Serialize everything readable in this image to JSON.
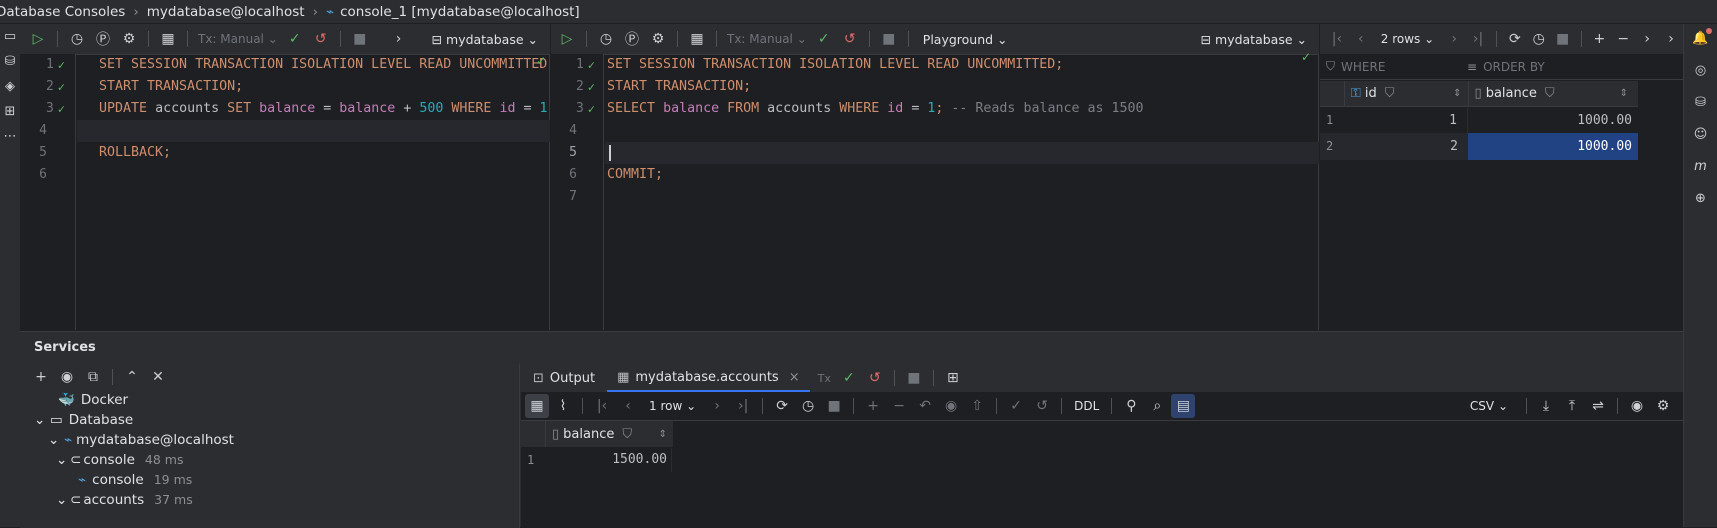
{
  "breadcrumb": {
    "items": [
      "Database Consoles",
      "mydatabase@localhost",
      "console_1 [mydatabase@localhost]"
    ]
  },
  "left_toolbar": {
    "tx_mode": "Tx: Manual",
    "datasource": "mydatabase"
  },
  "right_toolbar": {
    "tx_mode": "Tx: Manual",
    "mode": "Playground",
    "datasource": "mydatabase"
  },
  "result_toolbar": {
    "rows_label": "2 rows"
  },
  "left_editor": {
    "line_numbers": [
      "1",
      "2",
      "3",
      "4",
      "5",
      "6"
    ],
    "lines": {
      "l1": "SET SESSION TRANSACTION ISOLATION LEVEL READ UNCOMMITTED;",
      "l2": "START TRANSACTION;",
      "l3": {
        "k1": "UPDATE",
        "t1": "accounts",
        "k2": "SET",
        "c1": "balance",
        "eq": "=",
        "c2": "balance",
        "plus": "+",
        "n1": "500",
        "k3": "WHERE",
        "c3": "id",
        "eq2": "=",
        "n2": "1",
        "semi": ";",
        "cm": "--"
      },
      "l5": "ROLLBACK;"
    }
  },
  "right_editor": {
    "line_numbers": [
      "1",
      "2",
      "3",
      "4",
      "5",
      "6",
      "7"
    ],
    "lines": {
      "l1": "SET SESSION TRANSACTION ISOLATION LEVEL READ UNCOMMITTED;",
      "l2": "START TRANSACTION;",
      "l3": {
        "k1": "SELECT",
        "c1": "balance",
        "k2": "FROM",
        "t1": "accounts",
        "k3": "WHERE",
        "c2": "id",
        "eq": "=",
        "n1": "1",
        "semi": ";",
        "cm": "-- Reads balance as 1500"
      },
      "l6": "COMMIT;"
    }
  },
  "result_grid": {
    "filter_where": "WHERE",
    "filter_order": "ORDER BY",
    "columns": [
      "id",
      "balance"
    ],
    "rows": [
      {
        "row_num": "1",
        "id": "1",
        "balance": "1000.00"
      },
      {
        "row_num": "2",
        "id": "2",
        "balance": "1000.00"
      }
    ]
  },
  "services": {
    "title": "Services",
    "tree": {
      "docker": "Docker",
      "database": "Database",
      "datasource": "mydatabase@localhost",
      "console": "console",
      "console_time": "48 ms",
      "console_child": "console",
      "console_child_time": "19 ms",
      "accounts": "accounts",
      "accounts_time": "37 ms"
    }
  },
  "bottom_tabs": {
    "output": "Output",
    "accounts": "mydatabase.accounts"
  },
  "bottom_toolbar": {
    "rows_label": "1 row",
    "ddl": "DDL",
    "export_format": "CSV"
  },
  "bottom_grid": {
    "column": "balance",
    "rows": [
      {
        "row_num": "1",
        "balance": "1500.00"
      }
    ]
  },
  "colors": {
    "accent_selection": "#214283",
    "keyword": "#cf8e6d",
    "identifier": "#c77dba",
    "number": "#2aacb8",
    "success": "#5fb865",
    "danger": "#e06c6c"
  }
}
